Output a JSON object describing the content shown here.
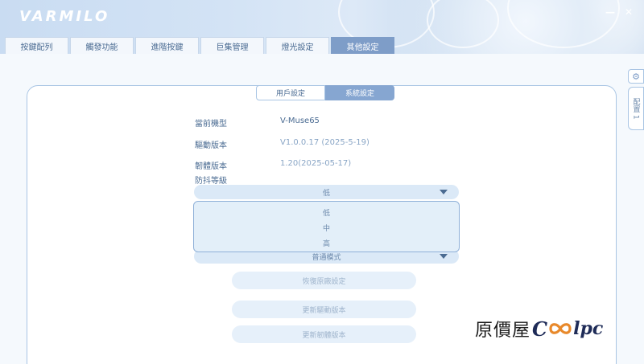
{
  "app": {
    "logo": "VARMILO",
    "window_controls": [
      "—",
      "✕"
    ]
  },
  "nav": {
    "tabs": [
      {
        "label": "按鍵配列",
        "active": false
      },
      {
        "label": "觸發功能",
        "active": false
      },
      {
        "label": "進階按鍵",
        "active": false
      },
      {
        "label": "巨集管理",
        "active": false
      },
      {
        "label": "燈光設定",
        "active": false
      },
      {
        "label": "其他設定",
        "active": true
      }
    ]
  },
  "subtabs": [
    {
      "label": "用戶設定",
      "active": false
    },
    {
      "label": "系統設定",
      "active": true
    }
  ],
  "info": {
    "model_label": "當前機型",
    "model_value": "V-Muse65",
    "driver_label": "驅動版本",
    "driver_value": "V1.0.0.17 (2025-5-19)",
    "firmware_label": "韌體版本",
    "firmware_value": "1.20(2025-05-17)",
    "debounce_label": "防抖等級"
  },
  "debounce_select": {
    "selected": "低",
    "options": [
      "低",
      "中",
      "高"
    ]
  },
  "mode_select": {
    "selected": "普通模式"
  },
  "buttons": {
    "reset": "恢復原廠設定",
    "update_driver": "更新驅動版本",
    "update_firmware": "更新韌體版本"
  },
  "side": {
    "gear_icon": "gear-icon",
    "profile_label": "配置 1"
  },
  "watermark": {
    "text": "原價屋",
    "brand_c": "C",
    "brand_rest": "lpc"
  },
  "colors": {
    "accent": "#7e9dc8",
    "active_tab": "#7e9dc8",
    "card_border": "#a9c5e4"
  }
}
